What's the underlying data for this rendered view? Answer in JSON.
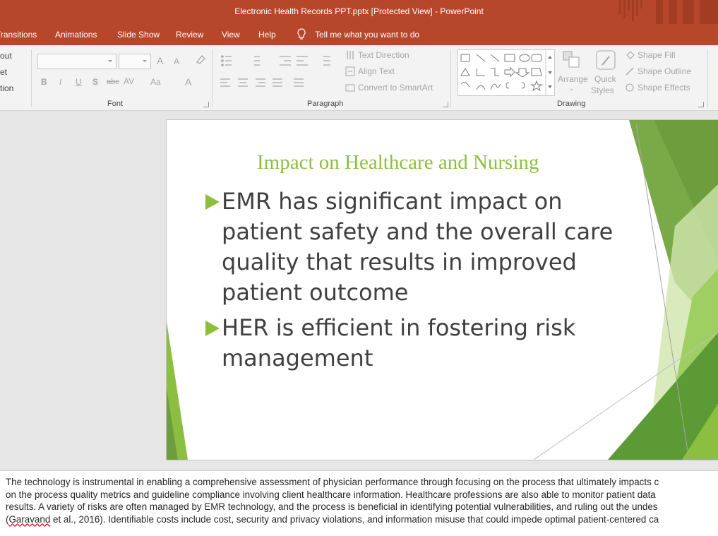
{
  "window": {
    "title": "Electronic Health Records PPT.pptx [Protected View]  -  PowerPoint"
  },
  "menu": {
    "tabs": [
      "Transitions",
      "Animations",
      "Slide Show",
      "Review",
      "View",
      "Help"
    ],
    "tell_me": "Tell me what you want to do"
  },
  "ribbon": {
    "left_cut": [
      "out",
      "et",
      "tion"
    ],
    "font_group": "Font",
    "paragraph_group": "Paragraph",
    "drawing_group": "Drawing",
    "text_direction": "Text Direction",
    "align_text": "Align Text",
    "convert_smartart": "Convert to SmartArt",
    "arrange": "Arrange",
    "quick": "Quick",
    "styles": "Styles",
    "shape_fill": "Shape Fill",
    "shape_outline": "Shape Outline",
    "shape_effects": "Shape Effects",
    "font_buttons": {
      "bold": "B",
      "italic": "I",
      "underline": "U",
      "shadow": "S",
      "strike": "abc",
      "spacing": "AV",
      "case": "Aa",
      "color": "A",
      "grow": "A",
      "shrink": "A"
    }
  },
  "slide": {
    "title": "Impact on Healthcare and Nursing",
    "bullets": [
      [
        "EMR has significant impact on",
        "patient safety and the overall care",
        "quality that results in improved",
        "patient outcome"
      ],
      [
        "HER is efficient in fostering risk",
        "management"
      ]
    ]
  },
  "notes": {
    "lines": [
      "The technology is instrumental in enabling a comprehensive assessment of physician performance through focusing on the process that ultimately impacts c",
      "on the process quality metrics and guideline compliance involving client healthcare information. Healthcare professions are also able to monitor patient data",
      "results. A variety of risks are often managed by EMR technology, and the process is beneficial in identifying potential vulnerabilities, and ruling out the undes"
    ],
    "last_line_cite": "Garavand",
    "last_line_start": "(",
    "last_line_rest": " et al., 2016). Identifiable costs include cost, security and privacy violations, and information misuse that could impede optimal patient-centered ca"
  },
  "colors": {
    "accent": "#b7472a",
    "slide_green": "#8cbf3f",
    "text": "#404040"
  }
}
